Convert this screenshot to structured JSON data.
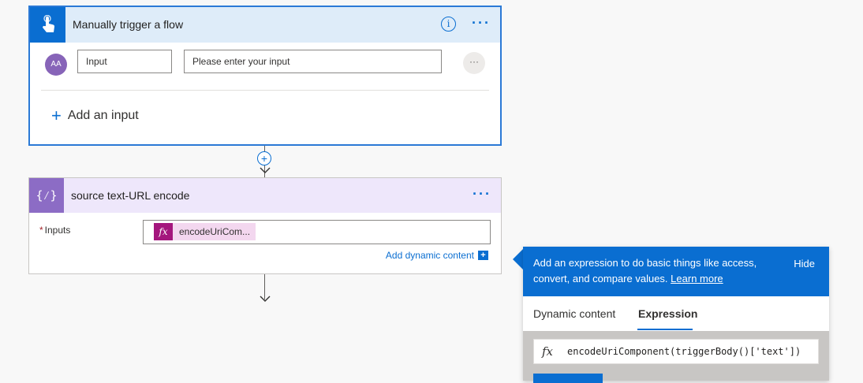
{
  "trigger_card": {
    "title": "Manually trigger a flow",
    "info_icon": "info-icon",
    "more_icon": "more-options-icon",
    "input_avatar": "AA",
    "input_name": "Input",
    "input_placeholder": "Please enter your input",
    "row_more": "···",
    "add_input_icon": "plus-icon",
    "add_input_label": "Add an input"
  },
  "connector": {
    "insert_icon": "plus-icon",
    "arrow_icon": "arrow-down-icon"
  },
  "compose_card": {
    "title": "source text-URL encode",
    "header_icon": "{⁄}",
    "required_mark": "*",
    "inputs_label": "Inputs",
    "token_icon": "fx",
    "token_label": "encodeUriCom...",
    "add_dynamic_label": "Add dynamic content",
    "add_dynamic_icon": "+"
  },
  "expression_panel": {
    "banner_text": "Add an expression to do basic things like access, convert, and compare values.",
    "learn_more": "Learn more",
    "hide_label": "Hide",
    "tabs": [
      {
        "label": "Dynamic content",
        "active": false
      },
      {
        "label": "Expression",
        "active": true
      }
    ],
    "fx_symbol": "fx",
    "expression_value": "encodeUriComponent(triggerBody()['text'])"
  },
  "colors": {
    "accent": "#0a6ed1",
    "trigger_header": "#deecf9",
    "compose_header": "#eee7fb",
    "compose_icon": "#8c6cc5",
    "token": "#a4167d"
  }
}
